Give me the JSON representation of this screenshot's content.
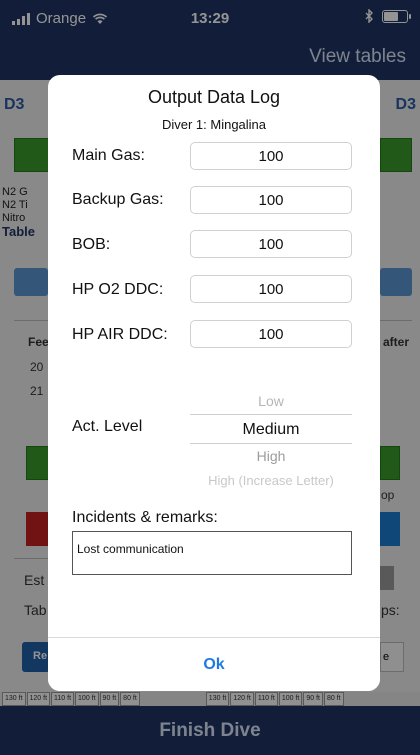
{
  "status_bar": {
    "carrier": "Orange",
    "time": "13:29"
  },
  "nav": {
    "view_tables": "View tables"
  },
  "background": {
    "d3_left": "D3",
    "d3_right": "D3",
    "n2_lines": [
      "N2 G",
      "N2 Ti",
      "Nitro"
    ],
    "table_label": "Table",
    "feet_label": "Fee",
    "depth_1": "20",
    "depth_2": "21",
    "after_label": "after",
    "op_label": "op",
    "est_label": "Est",
    "tab_label": "Tab",
    "ps_label": "ps:",
    "re_label": "Re",
    "e_label": "e"
  },
  "ruler": [
    "130 ft",
    "120 ft",
    "110 ft",
    "100 ft",
    "90 ft",
    "80 ft",
    "",
    "130 ft",
    "120 ft",
    "110 ft",
    "100 ft",
    "90 ft",
    "80 ft"
  ],
  "finish": {
    "label": "Finish Dive"
  },
  "dialog": {
    "title": "Output Data Log",
    "subtitle": "Diver 1: Mingalina",
    "fields": [
      {
        "label": "Main Gas:",
        "value": "100"
      },
      {
        "label": "Backup Gas:",
        "value": "100"
      },
      {
        "label": "BOB:",
        "value": "100"
      },
      {
        "label": "HP O2 DDC:",
        "value": "100"
      },
      {
        "label": "HP AIR DDC:",
        "value": "100"
      }
    ],
    "act_level": {
      "label": "Act. Level",
      "options": [
        "Low",
        "Medium",
        "High",
        "High (Increase Letter)"
      ],
      "selected": "Medium"
    },
    "remarks": {
      "label": "Incidents & remarks:",
      "value": "Lost communication"
    },
    "ok_label": "Ok"
  },
  "colors": {
    "navy": "#1f3563",
    "accent_blue": "#1f7be0",
    "green": "#3a9a2a",
    "red": "#c42222"
  }
}
